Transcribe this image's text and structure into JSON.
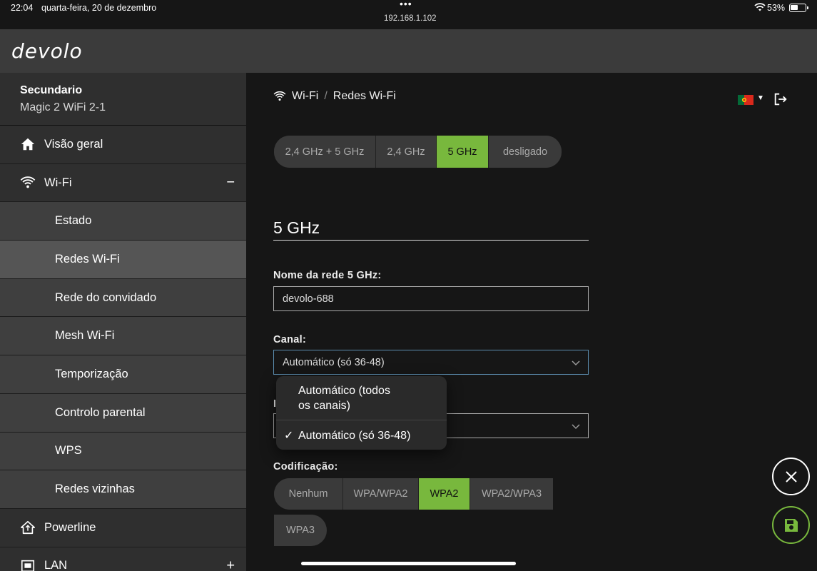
{
  "status": {
    "time": "22:04",
    "date": "quarta-feira, 20 de dezembro",
    "url": "192.168.1.102",
    "battery": "53%"
  },
  "brand": {
    "logo": "devolo"
  },
  "device": {
    "name": "Secundario",
    "model": "Magic 2 WiFi 2-1"
  },
  "nav": {
    "overview": "Visão geral",
    "wifi": "Wi-Fi",
    "wifi_toggle": "−",
    "sub": [
      "Estado",
      "Redes Wi-Fi",
      "Rede do convidado",
      "Mesh Wi-Fi",
      "Temporização",
      "Controlo parental",
      "WPS",
      "Redes vizinhas"
    ],
    "powerline": "Powerline",
    "lan": "LAN",
    "lan_toggle": "+"
  },
  "breadcrumb": {
    "section": "Wi-Fi",
    "sep": "/",
    "page": "Redes Wi-Fi"
  },
  "band_selector": {
    "options": [
      "2,4 GHz + 5 GHz",
      "2,4 GHz",
      "5 GHz",
      "desligado"
    ],
    "selected": "5 GHz"
  },
  "section": {
    "title": "5 GHz"
  },
  "form": {
    "ssid_label": "Nome da rede 5 GHz:",
    "ssid_value": "devolo-688",
    "channel_label": "Canal:",
    "channel_value": "Automático (só 36-48)",
    "hidden_label_fragment": "I",
    "encoding_label": "Codificação:",
    "encoding_options": [
      "Nenhum",
      "WPA/WPA2",
      "WPA2",
      "WPA2/WPA3",
      "WPA3"
    ],
    "encoding_selected": "WPA2"
  },
  "dropdown": {
    "option1_line1": "Automático (todos",
    "option1_line2": "os canais)",
    "option2": "Automático (só 36-48)",
    "checkmark": "✓"
  },
  "colors": {
    "accent": "#78b83d",
    "sidebar": "#333333",
    "background": "#161616"
  }
}
